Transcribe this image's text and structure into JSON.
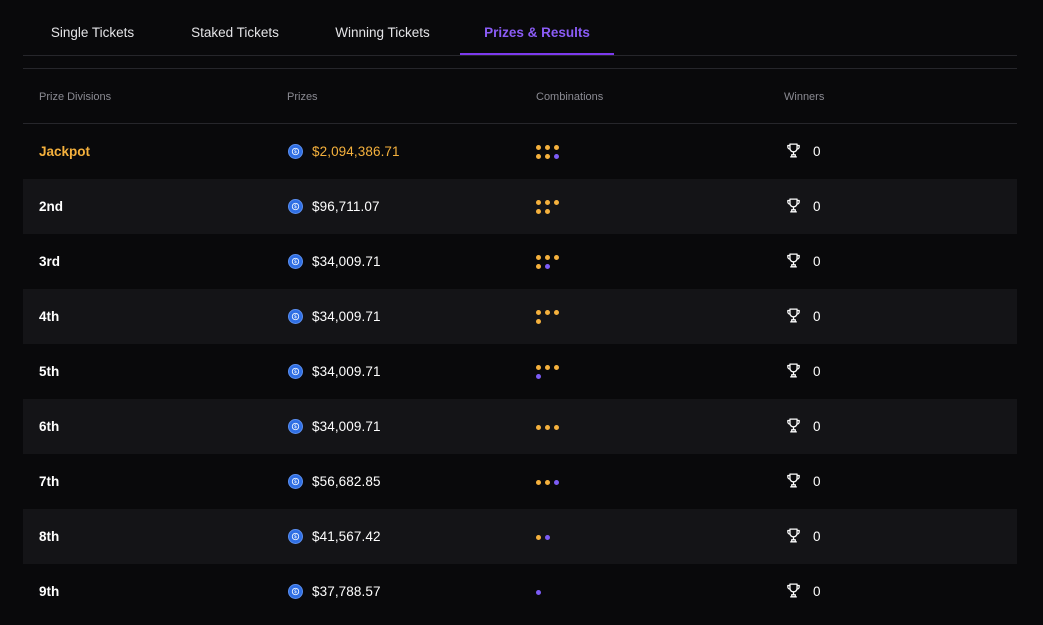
{
  "tabs": [
    {
      "label": "Single Tickets",
      "active": false
    },
    {
      "label": "Staked Tickets",
      "active": false
    },
    {
      "label": "Winning Tickets",
      "active": false
    },
    {
      "label": "Prizes & Results",
      "active": true
    }
  ],
  "table": {
    "headers": {
      "division": "Prize Divisions",
      "prizes": "Prizes",
      "combinations": "Combinations",
      "winners": "Winners"
    },
    "rows": [
      {
        "division": "Jackpot",
        "prize": "$2,094,386.71",
        "winners": "0",
        "combo_main": 5,
        "combo_bonus": 1
      },
      {
        "division": "2nd",
        "prize": "$96,711.07",
        "winners": "0",
        "combo_main": 5,
        "combo_bonus": 0
      },
      {
        "division": "3rd",
        "prize": "$34,009.71",
        "winners": "0",
        "combo_main": 4,
        "combo_bonus": 1
      },
      {
        "division": "4th",
        "prize": "$34,009.71",
        "winners": "0",
        "combo_main": 4,
        "combo_bonus": 0
      },
      {
        "division": "5th",
        "prize": "$34,009.71",
        "winners": "0",
        "combo_main": 3,
        "combo_bonus": 1
      },
      {
        "division": "6th",
        "prize": "$34,009.71",
        "winners": "0",
        "combo_main": 3,
        "combo_bonus": 0
      },
      {
        "division": "7th",
        "prize": "$56,682.85",
        "winners": "0",
        "combo_main": 2,
        "combo_bonus": 1
      },
      {
        "division": "8th",
        "prize": "$41,567.42",
        "winners": "0",
        "combo_main": 1,
        "combo_bonus": 1
      },
      {
        "division": "9th",
        "prize": "$37,788.57",
        "winners": "0",
        "combo_main": 0,
        "combo_bonus": 1
      }
    ]
  },
  "icons": {
    "prize_coin": "usdc-coin-icon",
    "winners": "trophy-icon"
  },
  "colors": {
    "accent": "#7c3aed",
    "jackpot": "#f5b13d",
    "main_ball": "#f5b13d",
    "bonus_ball": "#7c5cf6"
  }
}
